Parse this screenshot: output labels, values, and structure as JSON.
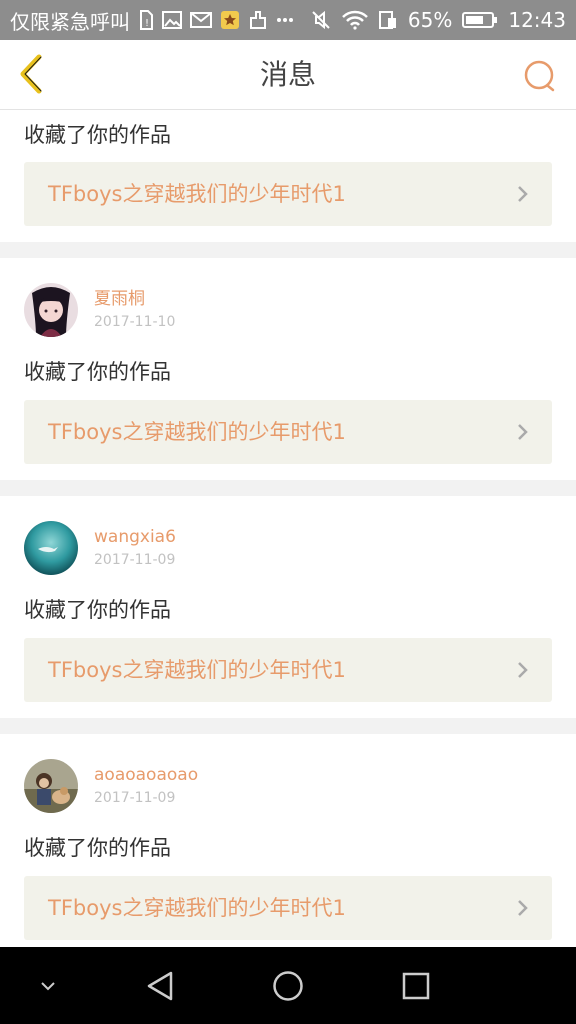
{
  "status_bar": {
    "carrier": "仅限紧急呼叫",
    "battery": "65%",
    "time": "12:43"
  },
  "header": {
    "title": "消息",
    "back_icon": "chevron-left-icon",
    "search_icon": "search-icon"
  },
  "colors": {
    "accent": "#e79b6b",
    "back_arrow": "#e8c11d",
    "link_bg": "#f2f2ea"
  },
  "notifications": [
    {
      "action": "收藏了你的作品",
      "work_title": "TFboys之穿越我们的少年时代1"
    },
    {
      "username": "夏雨桐",
      "date": "2017-11-10",
      "action": "收藏了你的作品",
      "work_title": "TFboys之穿越我们的少年时代1"
    },
    {
      "username": "wangxia6",
      "date": "2017-11-09",
      "action": "收藏了你的作品",
      "work_title": "TFboys之穿越我们的少年时代1"
    },
    {
      "username": "aoaoaoaoao",
      "date": "2017-11-09",
      "action": "收藏了你的作品",
      "work_title": "TFboys之穿越我们的少年时代1"
    }
  ],
  "nav_bar": {
    "icons": [
      "collapse-icon",
      "back-triangle-icon",
      "home-circle-icon",
      "recents-square-icon"
    ]
  }
}
